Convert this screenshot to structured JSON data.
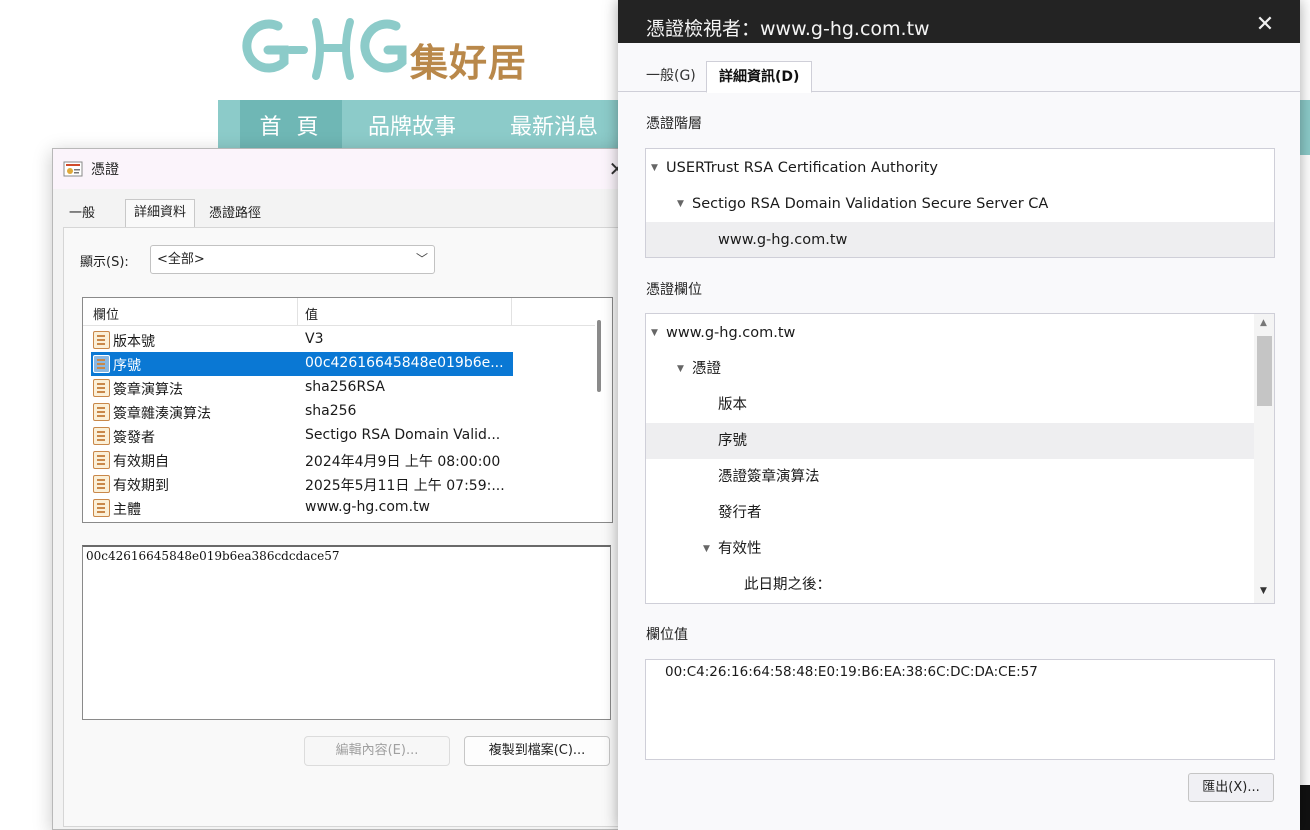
{
  "site": {
    "logo_text": "集好居",
    "nav": [
      "首 頁",
      "品牌故事",
      "最新消息"
    ]
  },
  "win_dialog": {
    "title": "憑證",
    "close": "✕",
    "tabs": [
      "一般",
      "詳細資料",
      "憑證路徑"
    ],
    "show_label": "顯示(S):",
    "show_value": "<全部>",
    "columns": {
      "field": "欄位",
      "value": "值"
    },
    "rows": [
      {
        "field": "版本號",
        "value": "V3"
      },
      {
        "field": "序號",
        "value": "00c42616645848e019b6e..."
      },
      {
        "field": "簽章演算法",
        "value": "sha256RSA"
      },
      {
        "field": "簽章雜湊演算法",
        "value": "sha256"
      },
      {
        "field": "簽發者",
        "value": "Sectigo RSA Domain Valid..."
      },
      {
        "field": "有效期自",
        "value": "2024年4月9日 上午 08:00:00"
      },
      {
        "field": "有效期到",
        "value": "2025年5月11日 上午 07:59:..."
      },
      {
        "field": "主體",
        "value": "www.g-hg.com.tw"
      }
    ],
    "selected_row": 1,
    "value_text": "00c42616645848e019b6ea386cdcdace57",
    "edit_button": "編輯內容(E)...",
    "copy_button": "複製到檔案(C)..."
  },
  "ff_viewer": {
    "title": "憑證檢視者：www.g-hg.com.tw",
    "close": "✕",
    "tabs": [
      "一般(G)",
      "詳細資訊(D)"
    ],
    "hierarchy_label": "憑證階層",
    "hierarchy": [
      {
        "label": "USERTrust RSA Certification Authority",
        "level": 0,
        "arrow": "▼"
      },
      {
        "label": "Sectigo RSA Domain Validation Secure Server CA",
        "level": 1,
        "arrow": "▼"
      },
      {
        "label": "www.g-hg.com.tw",
        "level": 2,
        "arrow": ""
      }
    ],
    "fields_label": "憑證欄位",
    "fields": [
      {
        "label": "www.g-hg.com.tw",
        "level": 0,
        "arrow": "▼"
      },
      {
        "label": "憑證",
        "level": 1,
        "arrow": "▼"
      },
      {
        "label": "版本",
        "level": 2,
        "arrow": ""
      },
      {
        "label": "序號",
        "level": 2,
        "arrow": ""
      },
      {
        "label": "憑證簽章演算法",
        "level": 2,
        "arrow": ""
      },
      {
        "label": "發行者",
        "level": 2,
        "arrow": ""
      },
      {
        "label": "有效性",
        "level": 2,
        "arrow": "▼"
      },
      {
        "label": "此日期之後：",
        "level": 3,
        "arrow": ""
      }
    ],
    "value_label": "欄位值",
    "value_text": "00:C4:26:16:64:58:48:E0:19:B6:EA:38:6C:DC:DA:CE:57",
    "export_button": "匯出(X)..."
  },
  "colors": {
    "site_teal": "#8ccbc9",
    "site_teal_dark": "#6fb7b5",
    "logo_gold": "#b9884a",
    "win_selection": "#0a78d4",
    "ff_titlebar": "#232323"
  },
  "icons": {
    "win_field_icon": "certificate-field-icon",
    "win_title_icon": "certificate-icon",
    "tree_expander": "triangle-down-icon"
  }
}
